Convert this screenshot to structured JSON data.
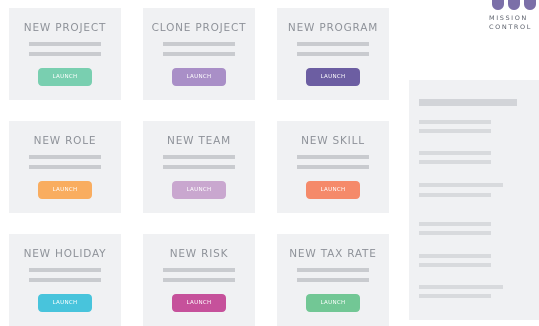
{
  "cards": [
    {
      "title": "NEW PROJECT",
      "launch": "LAUNCH",
      "color": "#79cfb0"
    },
    {
      "title": "CLONE PROJECT",
      "launch": "LAUNCH",
      "color": "#a98fc7"
    },
    {
      "title": "NEW PROGRAM",
      "launch": "LAUNCH",
      "color": "#6c5ea2"
    },
    {
      "title": "NEW ROLE",
      "launch": "LAUNCH",
      "color": "#f9ad60"
    },
    {
      "title": "NEW TEAM",
      "launch": "LAUNCH",
      "color": "#c9a7cf"
    },
    {
      "title": "NEW SKILL",
      "launch": "LAUNCH",
      "color": "#f58a6a"
    },
    {
      "title": "NEW HOLIDAY",
      "launch": "LAUNCH",
      "color": "#48c4dc"
    },
    {
      "title": "NEW RISK",
      "launch": "LAUNCH",
      "color": "#c6519b"
    },
    {
      "title": "NEW TAX RATE",
      "launch": "LAUNCH",
      "color": "#72c795"
    }
  ],
  "logo": {
    "line1": "MISSION",
    "line2": "CONTROL"
  }
}
